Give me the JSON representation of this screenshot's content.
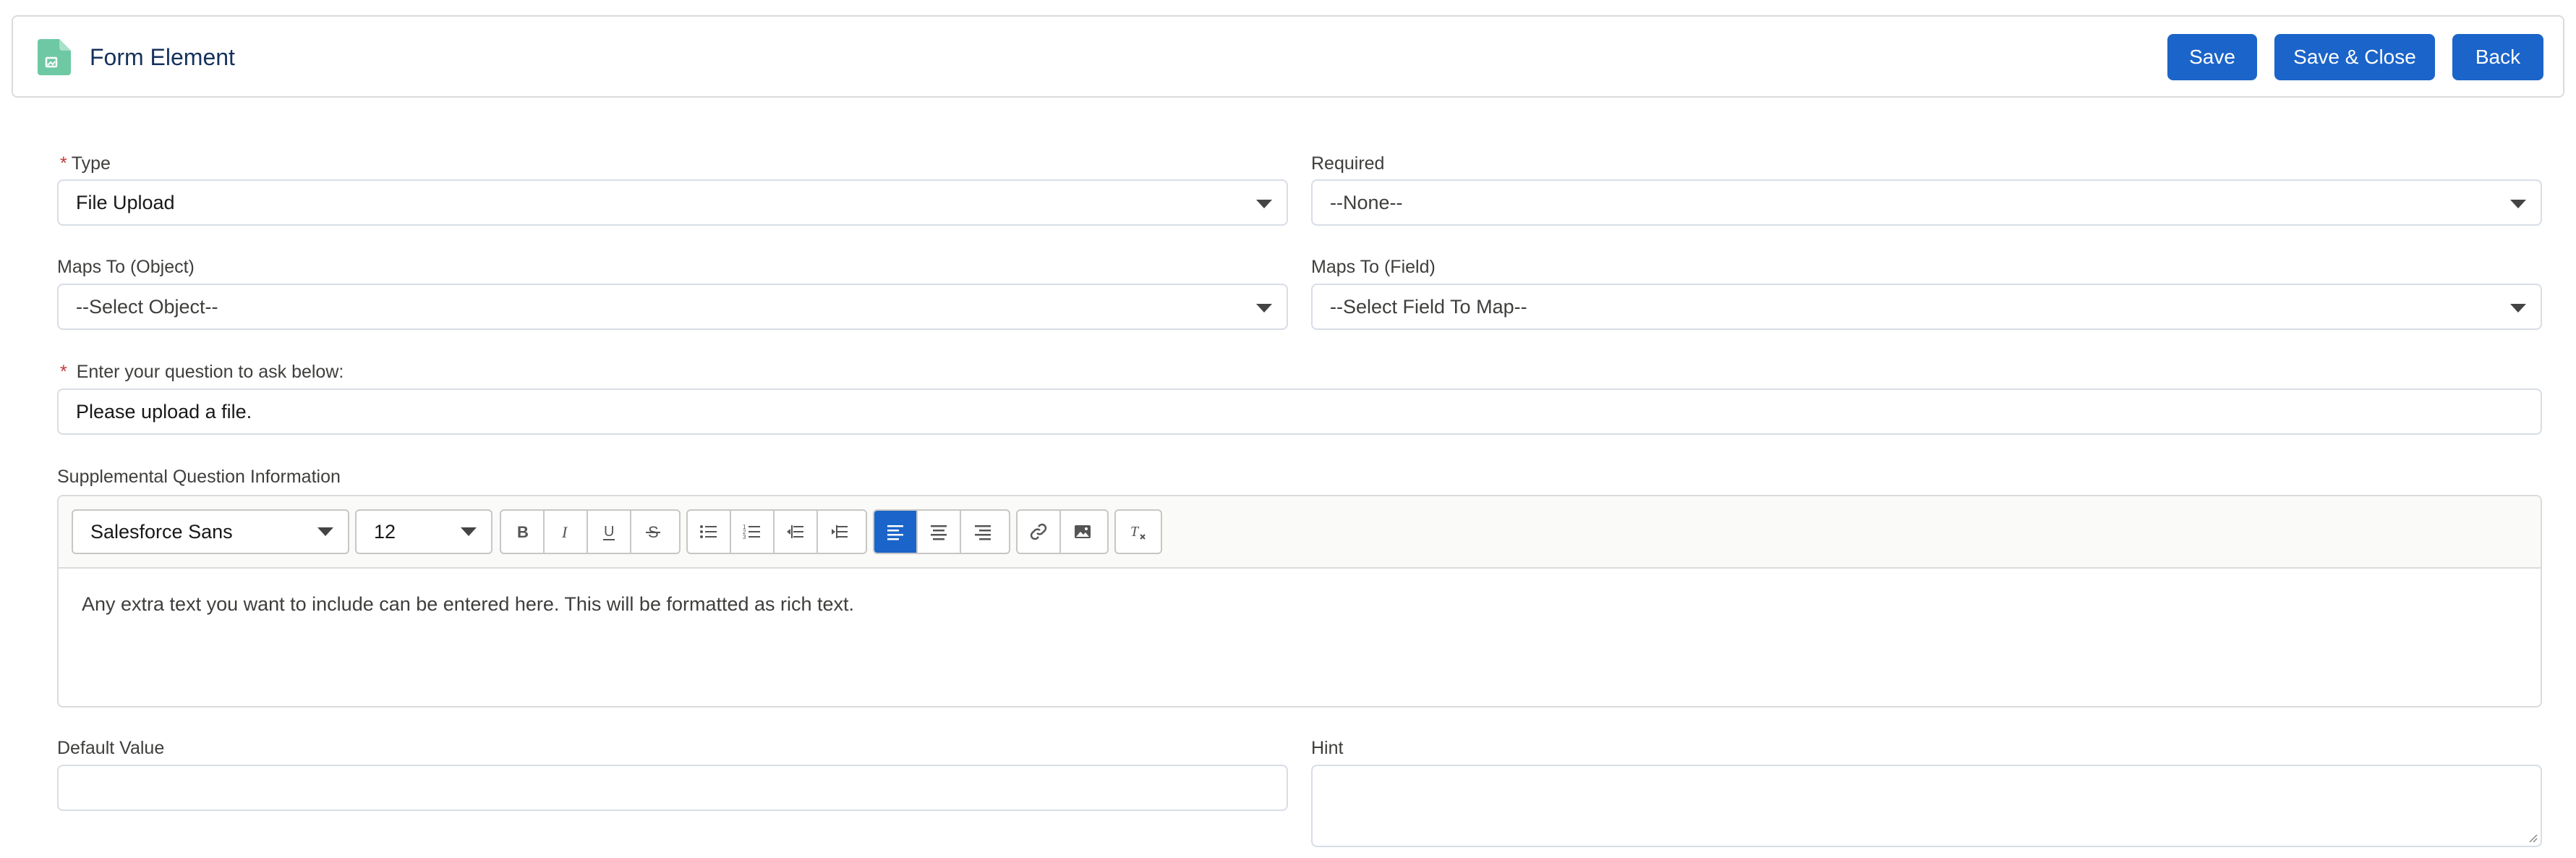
{
  "header": {
    "title": "Form Element",
    "icon": "form-document-icon",
    "icon_color": "#6ec8a4",
    "buttons": {
      "save": "Save",
      "save_close": "Save & Close",
      "back": "Back"
    }
  },
  "colors": {
    "brand": "#1b64c9",
    "required": "#c23934",
    "border": "#d8dde6"
  },
  "form": {
    "type": {
      "label": "Type",
      "required": true,
      "value": "File Upload"
    },
    "required_field": {
      "label": "Required",
      "value": "--None--"
    },
    "maps_to_object": {
      "label": "Maps To (Object)",
      "value": "--Select Object--"
    },
    "maps_to_field": {
      "label": "Maps To (Field)",
      "value": "--Select Field To Map--"
    },
    "question": {
      "label": "Enter your question to ask below:",
      "required": true,
      "value": "Please upload a file."
    },
    "supplemental": {
      "label": "Supplemental Question Information",
      "font_family_value": "Salesforce Sans",
      "font_size_value": "12",
      "body_text": "Any extra text you want to include can be entered here. This will be formatted as rich text.",
      "active_alignment": "align-left"
    },
    "default_value": {
      "label": "Default Value",
      "value": ""
    },
    "hint": {
      "label": "Hint",
      "value": ""
    }
  }
}
